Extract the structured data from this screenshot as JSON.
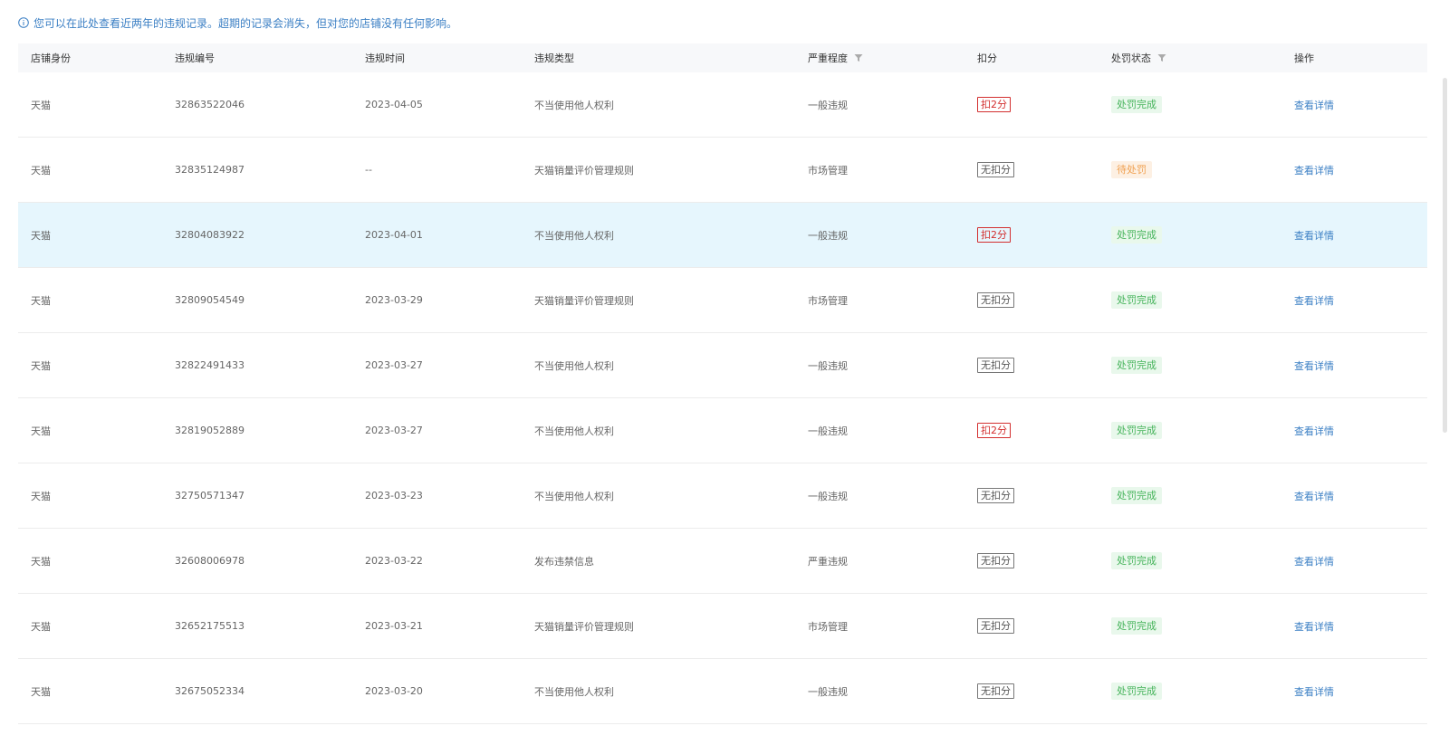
{
  "notice": {
    "text": "您可以在此处查看近两年的违规记录。超期的记录会消失，但对您的店铺没有任何影响。"
  },
  "colors": {
    "accent": "#3b7fc4",
    "deduct_red": "#d32f2f",
    "status_done": "#45b35a",
    "status_pending": "#f0a050",
    "highlight_row": "#e6f6fd"
  },
  "table": {
    "headers": [
      "店铺身份",
      "违规编号",
      "违规时间",
      "违规类型",
      "严重程度",
      "扣分",
      "处罚状态",
      "操作"
    ],
    "rows": [
      {
        "identity": "天猫",
        "id": "32863522046",
        "time": "2023-04-05",
        "type": "不当使用他人权利",
        "severity": "一般违规",
        "deduct": "扣2分",
        "deduct_kind": "deduct",
        "status": "处罚完成",
        "status_kind": "done",
        "action": "查看详情"
      },
      {
        "identity": "天猫",
        "id": "32835124987",
        "time": "--",
        "type": "天猫销量评价管理规则",
        "severity": "市场管理",
        "deduct": "无扣分",
        "deduct_kind": "none",
        "status": "待处罚",
        "status_kind": "pending",
        "action": "查看详情"
      },
      {
        "identity": "天猫",
        "id": "32804083922",
        "time": "2023-04-01",
        "type": "不当使用他人权利",
        "severity": "一般违规",
        "deduct": "扣2分",
        "deduct_kind": "deduct",
        "status": "处罚完成",
        "status_kind": "done",
        "action": "查看详情",
        "highlight": true
      },
      {
        "identity": "天猫",
        "id": "32809054549",
        "time": "2023-03-29",
        "type": "天猫销量评价管理规则",
        "severity": "市场管理",
        "deduct": "无扣分",
        "deduct_kind": "none",
        "status": "处罚完成",
        "status_kind": "done",
        "action": "查看详情"
      },
      {
        "identity": "天猫",
        "id": "32822491433",
        "time": "2023-03-27",
        "type": "不当使用他人权利",
        "severity": "一般违规",
        "deduct": "无扣分",
        "deduct_kind": "none",
        "status": "处罚完成",
        "status_kind": "done",
        "action": "查看详情"
      },
      {
        "identity": "天猫",
        "id": "32819052889",
        "time": "2023-03-27",
        "type": "不当使用他人权利",
        "severity": "一般违规",
        "deduct": "扣2分",
        "deduct_kind": "deduct",
        "status": "处罚完成",
        "status_kind": "done",
        "action": "查看详情"
      },
      {
        "identity": "天猫",
        "id": "32750571347",
        "time": "2023-03-23",
        "type": "不当使用他人权利",
        "severity": "一般违规",
        "deduct": "无扣分",
        "deduct_kind": "none",
        "status": "处罚完成",
        "status_kind": "done",
        "action": "查看详情"
      },
      {
        "identity": "天猫",
        "id": "32608006978",
        "time": "2023-03-22",
        "type": "发布违禁信息",
        "severity": "严重违规",
        "deduct": "无扣分",
        "deduct_kind": "none",
        "status": "处罚完成",
        "status_kind": "done",
        "action": "查看详情"
      },
      {
        "identity": "天猫",
        "id": "32652175513",
        "time": "2023-03-21",
        "type": "天猫销量评价管理规则",
        "severity": "市场管理",
        "deduct": "无扣分",
        "deduct_kind": "none",
        "status": "处罚完成",
        "status_kind": "done",
        "action": "查看详情"
      },
      {
        "identity": "天猫",
        "id": "32675052334",
        "time": "2023-03-20",
        "type": "不当使用他人权利",
        "severity": "一般违规",
        "deduct": "无扣分",
        "deduct_kind": "none",
        "status": "处罚完成",
        "status_kind": "done",
        "action": "查看详情"
      }
    ]
  }
}
